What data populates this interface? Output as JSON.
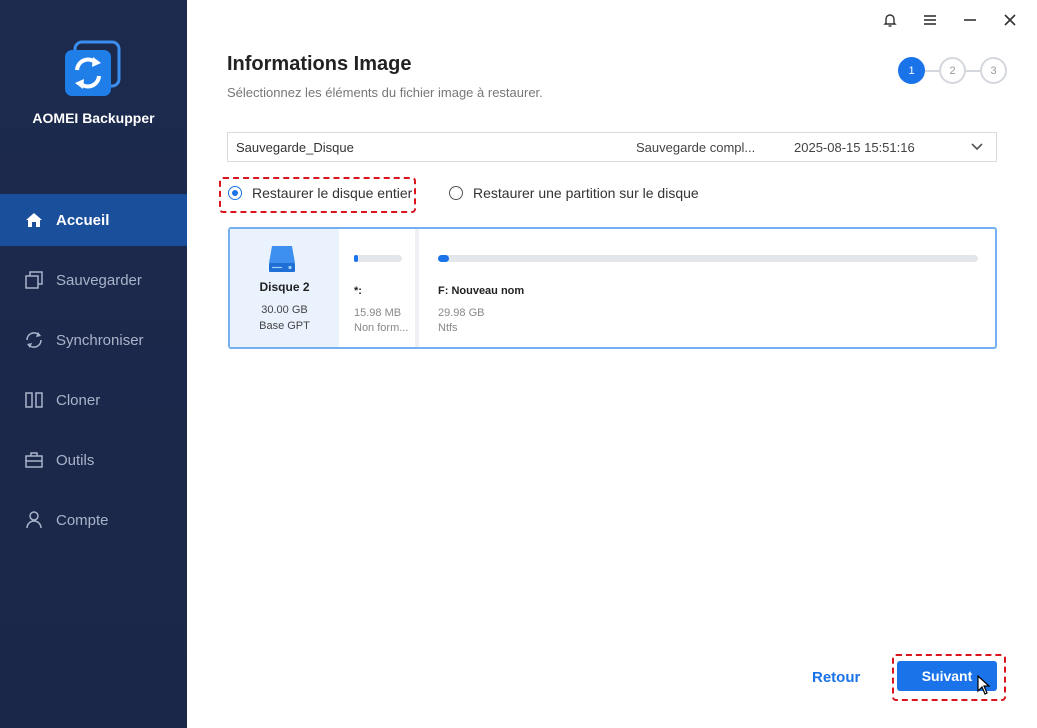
{
  "app": {
    "name": "AOMEI Backupper"
  },
  "sidebar": {
    "items": [
      {
        "label": "Accueil",
        "icon": "home-icon",
        "active": true
      },
      {
        "label": "Sauvegarder",
        "icon": "backup-icon"
      },
      {
        "label": "Synchroniser",
        "icon": "sync-icon"
      },
      {
        "label": "Cloner",
        "icon": "clone-icon"
      },
      {
        "label": "Outils",
        "icon": "toolbox-icon"
      },
      {
        "label": "Compte",
        "icon": "user-icon"
      }
    ]
  },
  "titlebar": {
    "icons": [
      "bell-icon",
      "menu-icon",
      "minimize-icon",
      "close-icon"
    ]
  },
  "header": {
    "title": "Informations Image",
    "subtitle": "Sélectionnez les éléments du fichier image à restaurer."
  },
  "steps": {
    "items": [
      "1",
      "2",
      "3"
    ],
    "current": 1
  },
  "image": {
    "name": "Sauvegarde_Disque",
    "type": "Sauvegarde compl...",
    "date": "2025-08-15 15:51:16"
  },
  "options": {
    "whole_disk": "Restaurer le disque entier",
    "partition": "Restaurer une partition sur le disque",
    "selected": "whole_disk"
  },
  "disk": {
    "name": "Disque 2",
    "size": "30.00 GB",
    "type": "Base GPT",
    "partitions": [
      {
        "label": "*:",
        "size": "15.98 MB",
        "fs": "Non form...",
        "used_fraction": 0.05
      },
      {
        "label": "F: Nouveau nom",
        "size": "29.98 GB",
        "fs": "Ntfs",
        "used_fraction": 0.02
      }
    ]
  },
  "buttons": {
    "back": "Retour",
    "next": "Suivant"
  },
  "colors": {
    "accent": "#1a73e8",
    "sidebar": "#1c2a4e",
    "highlight": "#d9141c"
  }
}
